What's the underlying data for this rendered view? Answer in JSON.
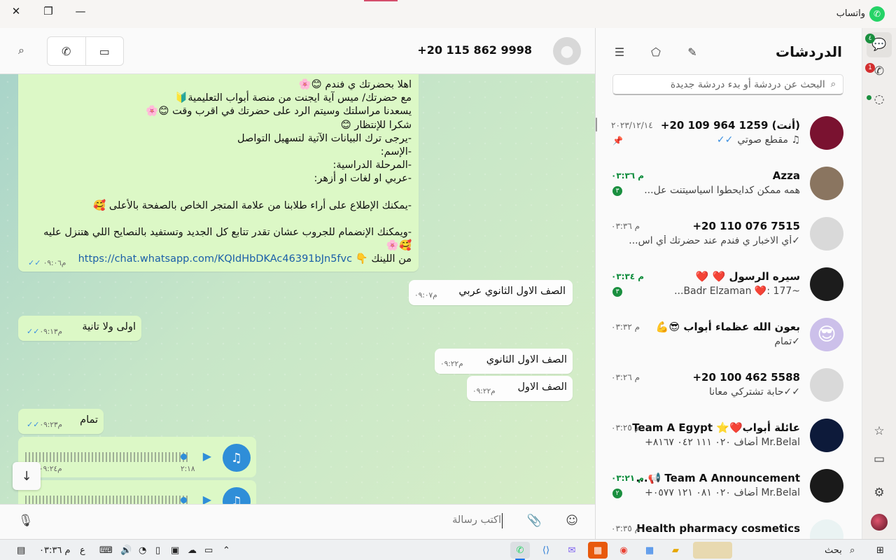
{
  "titlebar": {
    "app_name": "واتساب",
    "close_glyph": "✕",
    "restore_glyph": "❐",
    "minimize_glyph": "—"
  },
  "rail": {
    "chats_badge": "٤",
    "calls_badge": "1"
  },
  "chatlist": {
    "title": "الدردشات",
    "search_placeholder": "البحث عن دردشة أو بدء دردشة جديدة",
    "chats": [
      {
        "name": "(أنت) 1259 964 109 20+",
        "preview": "♫ مقطع صوتي",
        "ticks": "✓✓",
        "time": "٢٠٢٣/١٢/١٤",
        "pinned": true,
        "selected": true,
        "avatar_color": "#7a1230"
      },
      {
        "name": "Azza",
        "preview": "همه ممكن كدايحطوا  اسياسيتنت عل...",
        "time": "م ٠٣:٣٦",
        "time_green": true,
        "badge": "٣",
        "avatar_color": "#8a7560"
      },
      {
        "name": "7515 076 110 20+",
        "preview": "✓أي الاخبار ي فندم عند حضرتك أي اس...",
        "time": "م ٠٣:٣٦",
        "avatar_color": "#d9d9d9"
      },
      {
        "name": "سيره الرسول ❤️ ❤️",
        "preview": "~177 :❤️ Badr Elzaman...",
        "time": "م ٠٣:٣٤",
        "time_green": true,
        "badge": "٣",
        "avatar_color": "#1c1c1c"
      },
      {
        "name": "بعون الله عظماء أبواب 😎💪",
        "preview": "✓تمام",
        "time": "م ٠٣:٣٢",
        "avatar_color": "#ccc0ea",
        "emoji": "😎"
      },
      {
        "name": "5588 462 100 20+",
        "preview": "✓✓حابة تشتركي معانا",
        "time": "م ٠٣:٢٦",
        "avatar_color": "#d9d9d9"
      },
      {
        "name": "عائلة أبواب❤️⭐ Team A Egypt",
        "preview": "Mr.Belal أضاف ٠٢٠ ١١١ ٠٤٢ ٨١٦٧+",
        "time": "م ٠٣:٢٥",
        "avatar_color": "#0d1a3a"
      },
      {
        "name": "Team A Announcement 📢...",
        "preview": "Mr.Belal أضاف ٠٢٠ ٠٨١ ١٢١ ٠٥٧٧+",
        "time": "م ٠٣:٢١",
        "time_green": true,
        "badge": "٢",
        "avatar_color": "#1a1a1a"
      },
      {
        "name": "Health pharmacy cosmetics",
        "preview": "",
        "time": "م ٠٣:٣٥",
        "avatar_color": "#eaf3f3"
      }
    ]
  },
  "conversation": {
    "contact": "+20 115 862 9998",
    "big_message": {
      "lines": [
        "اهلا بحضرتك ي فندم 😊🌸",
        "مع حضرتك/ ميس آية ايجنت من منصة أبواب التعليمية🔰",
        "يسعدنا مراسلتك وسيتم الرد على حضرتك في اقرب وقت 😊🌸",
        "شكرا للإنتظار 😊",
        "-يرجى ترك البيانات الآتية لتسهيل التواصل",
        "-الإسم:",
        "-المرحلة الدراسية:",
        "-عربي او لغات او أزهر:",
        "",
        "-يمكنك الإطلاع على أراء طلابنا من علامة المتجر الخاص بالصفحة بالأعلى 🥰",
        "",
        "-ويمكنك الإنضمام للجروب عشان تقدر تتابع كل الجديد وتستفيد بالنصايح اللي هتنزل عليه",
        "🥰🌸"
      ],
      "link_prefix": "من اللينك 👇",
      "link": "https://chat.whatsapp.com/KQIdHbDKAc46391bJn5fvc",
      "time": "م٠٩:٠٦"
    },
    "messages": [
      {
        "text": "الصف الاول الثانوي عربي",
        "time": "م٠٩:٠٧",
        "dir": "in"
      },
      {
        "text": "اولى ولا تانية",
        "time": "م٠٩:١٣",
        "dir": "out"
      },
      {
        "text": "الصف الاول الثانوي",
        "time": "م٠٩:٢٢",
        "dir": "in"
      },
      {
        "text": "الصف الاول",
        "time": "م٠٩:٢٢",
        "dir": "in"
      },
      {
        "text": "تمام",
        "time": "م٠٩:٢٣",
        "dir": "out"
      }
    ],
    "voice_notes": [
      {
        "duration": "٢:١٨",
        "time": "م٠٩:٢٤"
      }
    ],
    "composer_placeholder": "اكتب رسالة"
  },
  "taskbar": {
    "time": "م ٠٣:٣٦",
    "lang": "ع",
    "search_label": "بحث"
  }
}
